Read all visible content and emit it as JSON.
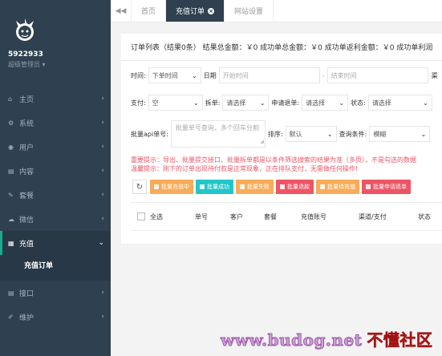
{
  "sidebar": {
    "username": "5922933",
    "role": "超级管理员",
    "menu": [
      {
        "icon": "home-icon",
        "glyph": "⌂",
        "label": "主页"
      },
      {
        "icon": "cogs-icon",
        "glyph": "⚙",
        "label": "系统"
      },
      {
        "icon": "users-icon",
        "glyph": "👥",
        "label": "用户"
      },
      {
        "icon": "file-icon",
        "glyph": "▤",
        "label": "内容"
      },
      {
        "icon": "edit-icon",
        "glyph": "✎",
        "label": "套餐"
      },
      {
        "icon": "wechat-icon",
        "glyph": "☁",
        "label": "微信"
      },
      {
        "icon": "file-text-icon",
        "glyph": "▦",
        "label": "充值"
      }
    ],
    "submenu_item": "充值订单",
    "menu_bottom": [
      {
        "icon": "file-icon",
        "glyph": "▤",
        "label": "接口"
      },
      {
        "icon": "wrench-icon",
        "glyph": "✐",
        "label": "维护"
      }
    ]
  },
  "tabs": {
    "back_glyph": "◀◀",
    "items": [
      "首页",
      "充值订单",
      "网站设置"
    ]
  },
  "panel": {
    "summary": "订单列表（结果0条）  结果总金额：￥0  成功单总金额：￥0  成功单返利金额：￥0  成功单利润",
    "time_label": "时间:",
    "time_select": "下单时间",
    "date_label": "日期",
    "start_placeholder": "开始时间",
    "dash": "-",
    "end_placeholder": "结束时间",
    "cut_label": "渠",
    "pay_label": "支付:",
    "pay_select": "空",
    "split_label": "拆单:",
    "split_select": "请选择",
    "refund_label": "申请退单:",
    "refund_select": "请选择",
    "status_label": "状态:",
    "status_select": "请选择",
    "batch_label": "批量api单号:",
    "batch_placeholder": "批量单号查询，多个回车分割",
    "sort_label": "排序:",
    "sort_select": "默认",
    "query_label": "查询条件:",
    "query_select": "模糊",
    "warn1": "重要提示：导出、批量提交接口、批量拆单都是以条件筛选搜索的结果为准（多页），不是勾选的数据",
    "warn2": "温馨提示：刚下的订单出现待付款是正常现象，正在排队支付，无需做任何操作!",
    "buttons": [
      {
        "label": "批量充值中",
        "color": "#f8ac59"
      },
      {
        "label": "批量成功",
        "color": "#23c6c8"
      },
      {
        "label": "批量失败",
        "color": "#f8ac59"
      },
      {
        "label": "批量退款",
        "color": "#ed5565"
      },
      {
        "label": "批量待充值",
        "color": "#f8ac59"
      },
      {
        "label": "批量申请退单",
        "color": "#ed5565"
      }
    ],
    "columns": [
      "全选",
      "单号",
      "客户",
      "套餐",
      "充值账号",
      "渠道/支付",
      "状态"
    ]
  },
  "watermark": {
    "en": "www.budog.net",
    "cn": "不懂社区"
  }
}
